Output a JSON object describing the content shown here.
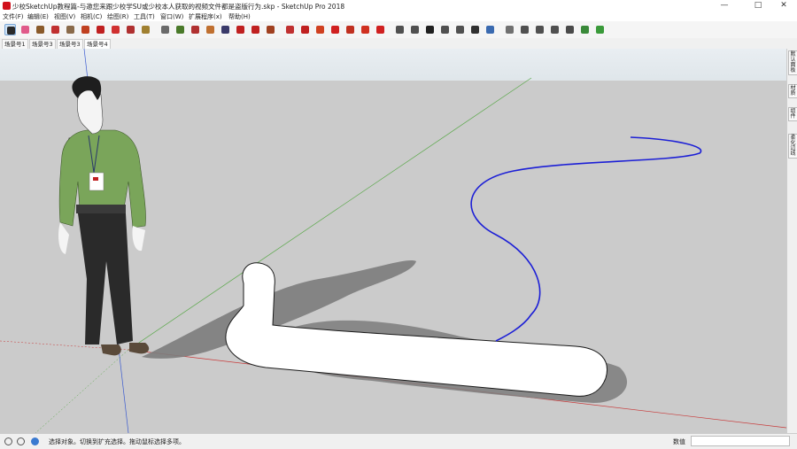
{
  "window": {
    "title": "少校SketchUp教程篇-与邀您来跟少校学SU或少校本人获取的视频文件都是盗版行为.skp - SketchUp Pro 2018",
    "minimize_glyph": "—",
    "maximize_glyph": "□",
    "close_glyph": "✕"
  },
  "menu": {
    "items": [
      {
        "label": "文件(F)"
      },
      {
        "label": "编辑(E)"
      },
      {
        "label": "视图(V)"
      },
      {
        "label": "相机(C)"
      },
      {
        "label": "绘图(R)"
      },
      {
        "label": "工具(T)"
      },
      {
        "label": "窗口(W)"
      },
      {
        "label": "扩展程序(x)"
      },
      {
        "label": "帮助(H)"
      }
    ]
  },
  "toolbar": {
    "tools": [
      {
        "name": "select-tool",
        "color": "#2a2a2a"
      },
      {
        "name": "eraser-tool",
        "color": "#e05a8a"
      },
      {
        "name": "line-tool",
        "color": "#8a5a2a"
      },
      {
        "name": "arc-tool",
        "color": "#c03030"
      },
      {
        "name": "rectangle-tool",
        "color": "#8a6a4a"
      },
      {
        "name": "push-pull-tool",
        "color": "#c04020"
      },
      {
        "name": "move-tool",
        "color": "#c02020"
      },
      {
        "name": "rotate-tool",
        "color": "#d03030"
      },
      {
        "name": "scale-tool",
        "color": "#b03030"
      },
      {
        "name": "tape-measure-tool",
        "color": "#a08030"
      },
      {
        "name": "text-tool",
        "color": "#6a6a6a"
      },
      {
        "name": "paint-bucket-tool",
        "color": "#4a7a2a"
      },
      {
        "name": "orbit-tool",
        "color": "#b03030"
      },
      {
        "name": "pan-tool",
        "color": "#c07030"
      },
      {
        "name": "zoom-tool",
        "color": "#3a3a6a"
      },
      {
        "name": "zoom-extents-tool",
        "color": "#c02020"
      },
      {
        "name": "warehouse-tool",
        "color": "#c02020"
      },
      {
        "name": "extension-warehouse-tool",
        "color": "#a04020"
      },
      {
        "name": "components-tool",
        "color": "#c03030"
      },
      {
        "name": "layout-tool",
        "color": "#c02020"
      },
      {
        "name": "style-builder-tool",
        "color": "#d04020"
      },
      {
        "name": "settings-tool",
        "color": "#d02020"
      },
      {
        "name": "iso-view-tool",
        "color": "#c03020"
      },
      {
        "name": "folder-tool",
        "color": "#d03020"
      },
      {
        "name": "export-tool",
        "color": "#d02020"
      },
      {
        "name": "top-view-tool",
        "color": "#505050"
      },
      {
        "name": "front-view-tool",
        "color": "#505050"
      },
      {
        "name": "right-view-tool",
        "color": "#202020"
      },
      {
        "name": "back-view-tool",
        "color": "#505050"
      },
      {
        "name": "left-view-tool",
        "color": "#505050"
      },
      {
        "name": "perspective-tool",
        "color": "#303030"
      },
      {
        "name": "shaded-tool",
        "color": "#3a6ab0"
      },
      {
        "name": "xray-tool",
        "color": "#707070"
      },
      {
        "name": "section-plane-tool",
        "color": "#505050"
      },
      {
        "name": "section-display-tool",
        "color": "#505050"
      },
      {
        "name": "section-cut-tool",
        "color": "#505050"
      },
      {
        "name": "shield-tool",
        "color": "#4a4a4a"
      },
      {
        "name": "sandbox-tool",
        "color": "#3a8a3a"
      },
      {
        "name": "recycle-tool",
        "color": "#3a9a3a"
      }
    ]
  },
  "scene_tabs": [
    {
      "label": "场景号1"
    },
    {
      "label": "场景号3"
    },
    {
      "label": "场景号3"
    },
    {
      "label": "场景号4"
    }
  ],
  "side_panel": {
    "tabs": [
      {
        "label": "默认面板"
      },
      {
        "label": "材质"
      },
      {
        "label": "组件"
      },
      {
        "label": "柔化边线"
      }
    ]
  },
  "status": {
    "text": "选择对象。切换到扩充选择。拖动鼠标选择多项。",
    "measurement_label": "数值"
  },
  "colors": {
    "viewport_ground": "#cbcbcb",
    "curve_blue": "#1c1fd6",
    "axis_green": "#5aa84a",
    "axis_red": "#c83a3a",
    "axis_blue": "#3a5ad0",
    "shirt_green": "#7aa55a",
    "pants_dark": "#2a2a2a",
    "shadow": "#7c7c7c"
  }
}
